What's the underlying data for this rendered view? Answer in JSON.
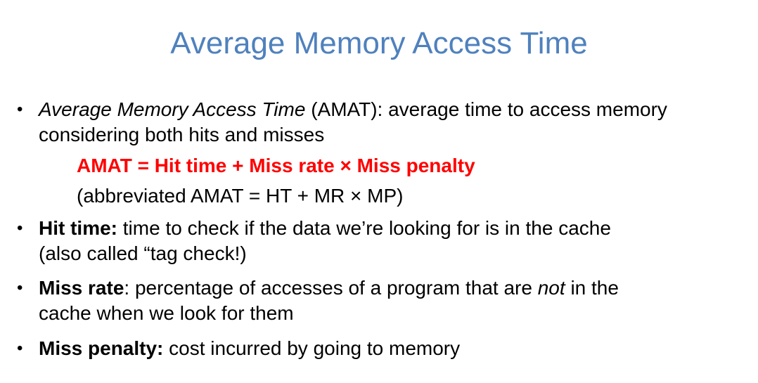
{
  "title": "Average Memory Access Time",
  "bullets": [
    {
      "line1_term": "Average Memory Access Time",
      "line1_rest": " (AMAT):  average time to access memory",
      "line2": "considering both hits and misses"
    },
    {
      "term": "Hit time:",
      "line1_rest": " time to check if the data we’re looking for is in the cache",
      "line2": "(also called “tag check!)"
    },
    {
      "term": "Miss rate",
      "line1_mid": ": percentage of accesses of a program that are ",
      "line1_emph": "not",
      "line1_end": " in the",
      "line2": "cache when we look for them"
    },
    {
      "term": "Miss penalty:",
      "line1_rest": " cost incurred by going to memory"
    }
  ],
  "formula": "AMAT = Hit time + Miss rate × Miss penalty",
  "abbreviation": "(abbreviated AMAT = HT + MR × MP)",
  "bullet_glyph": "•",
  "colors": {
    "title": "#4f81bd",
    "formula": "#ff0000"
  }
}
